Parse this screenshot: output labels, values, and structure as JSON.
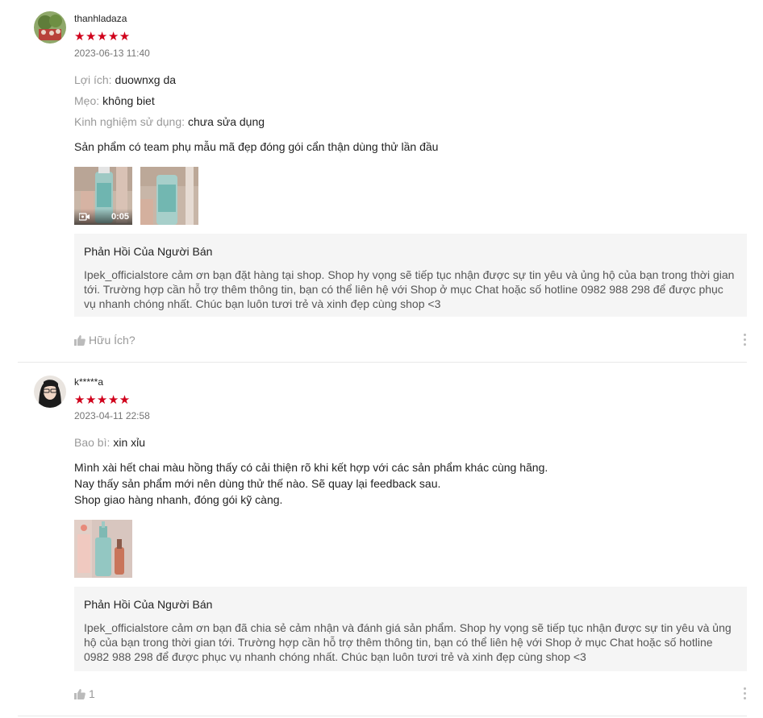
{
  "reviews": [
    {
      "username": "thanhladaza",
      "stars": "★★★★★",
      "time": "2023-06-13 11:40",
      "attributes": [
        {
          "label": "Lợi ích:",
          "value": "duownxg da"
        },
        {
          "label": "Mẹo:",
          "value": "không biet"
        },
        {
          "label": "Kinh nghiệm sử dụng:",
          "value": "chưa sửa dụng"
        }
      ],
      "comment": "Sản phẩm có team phụ mẫu mã đẹp đóng gói cẩn thận dùng thử lần đầu",
      "video_duration": "0:05",
      "reply_title": "Phản Hồi Của Người Bán",
      "reply_body": "Ipek_officialstore cảm ơn bạn đặt hàng tại shop. Shop hy vọng sẽ tiếp tục nhận được sự tin yêu và ủng hộ của bạn trong thời gian tới. Trường hợp cần hỗ trợ thêm thông tin, bạn có thể liên hệ với Shop ở mục Chat hoặc số hotline 0982 988 298 để được phục vụ nhanh chóng nhất. Chúc bạn luôn tươi trẻ và xinh đẹp cùng shop <3",
      "helpful": "Hữu Ích?"
    },
    {
      "username": "k*****a",
      "stars": "★★★★★",
      "time": "2023-04-11 22:58",
      "attributes": [
        {
          "label": "Bao bì:",
          "value": "xin xỉu"
        }
      ],
      "comment": "Mình xài hết chai màu hồng thấy có cải thiện rõ khi kết hợp với các sản phẩm khác cùng hãng.\nNay thấy sản phẩm mới nên dùng thử thế nào. Sẽ quay lại feedback sau.\nShop giao hàng nhanh, đóng gói kỹ càng.",
      "reply_title": "Phản Hồi Của Người Bán",
      "reply_body": "Ipek_officialstore cảm ơn bạn đã chia sẻ cảm nhận và đánh giá sản phẩm. Shop hy vọng sẽ tiếp tục nhận được sự tin yêu và ủng hộ của bạn trong thời gian tới. Trường hợp cần hỗ trợ thêm thông tin, bạn có thể liên hệ với Shop ở mục Chat hoặc số hotline 0982 988 298 để được phục vụ nhanh chóng nhất. Chúc bạn luôn tươi trẻ và xinh đẹp cùng shop <3",
      "like_count": "1"
    }
  ],
  "icons": {
    "like": "thumbs-up-icon",
    "more": "more-vertical-icon",
    "video": "video-camera-icon"
  },
  "colors": {
    "star": "#d0011b",
    "reply_bg": "#f5f5f5",
    "muted": "#999999"
  }
}
